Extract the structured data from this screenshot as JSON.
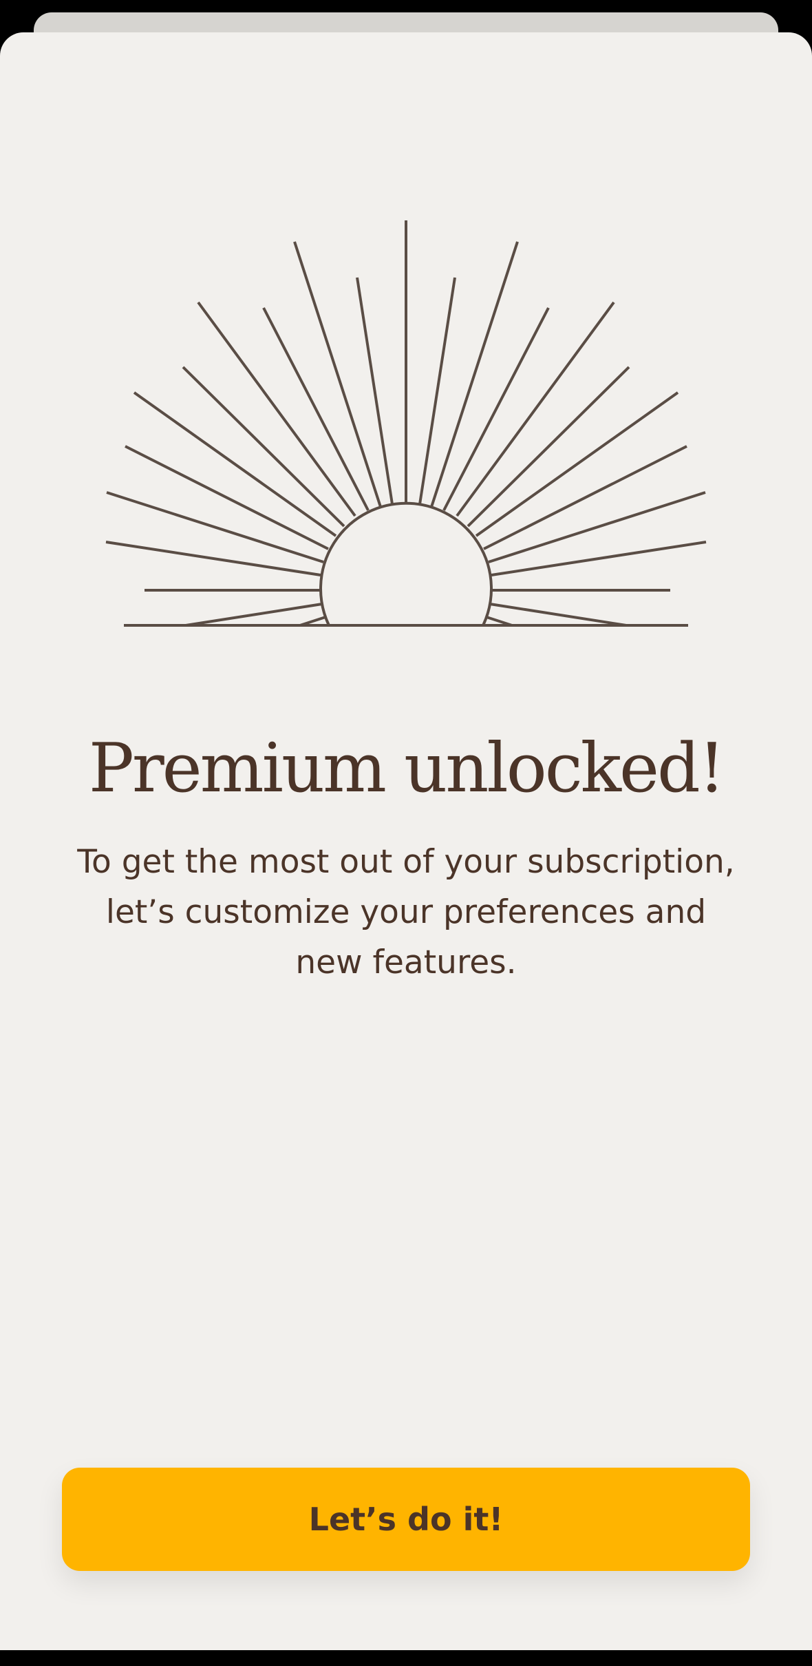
{
  "onboarding": {
    "illustration_icon": "sunburst-icon",
    "title": "Premium unlocked!",
    "description": "To get the most out of your subscription, let’s customize your preferences and new features.",
    "cta_label": "Let’s do it!"
  },
  "colors": {
    "background": "#f2f0ed",
    "text": "#4b3428",
    "accent": "#ffb400",
    "illustration_stroke": "#5a4d45"
  }
}
